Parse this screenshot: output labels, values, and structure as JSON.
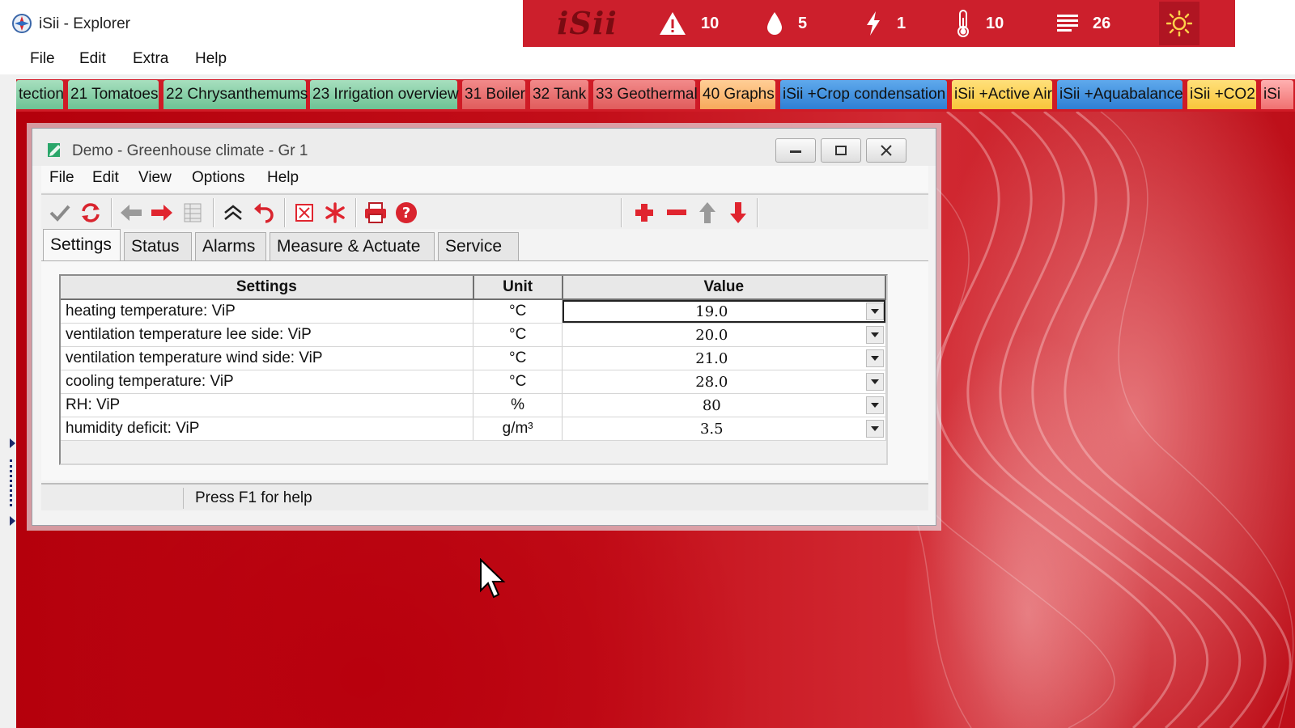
{
  "explorer": {
    "title": "iSii - Explorer",
    "menu": [
      "File",
      "Edit",
      "Extra",
      "Help"
    ]
  },
  "status_strip": {
    "logo": "iSii",
    "alarms": "10",
    "water": "5",
    "power": "1",
    "temperature": "10",
    "list": "26",
    "accent": "#cc1f2c"
  },
  "tabs": [
    {
      "label": "tection",
      "color": "green"
    },
    {
      "label": "21 Tomatoes",
      "color": "green"
    },
    {
      "label": "22 Chrysanthemums",
      "color": "green"
    },
    {
      "label": "23 Irrigation overview",
      "color": "green"
    },
    {
      "label": "31 Boiler",
      "color": "red"
    },
    {
      "label": "32 Tank",
      "color": "red"
    },
    {
      "label": "33 Geothermal",
      "color": "red"
    },
    {
      "label": "40 Graphs",
      "color": "orange"
    },
    {
      "label": "iSii +Crop condensation",
      "color": "blue"
    },
    {
      "label": "iSii +Active Air",
      "color": "yellow"
    },
    {
      "label": "iSii +Aquabalance",
      "color": "blue"
    },
    {
      "label": "iSii +CO2",
      "color": "yellow"
    },
    {
      "label": "iSi",
      "color": "pink"
    }
  ],
  "dialog": {
    "title": "Demo - Greenhouse climate - Gr 1",
    "menu": [
      "File",
      "Edit",
      "View",
      "Options",
      "Help"
    ],
    "tabs": [
      "Settings",
      "Status",
      "Alarms",
      "Measure & Actuate",
      "Service"
    ],
    "active_tab": "Settings",
    "table": {
      "headers": [
        "Settings",
        "Unit",
        "Value"
      ],
      "rows": [
        {
          "setting": "heating temperature: ViP",
          "unit": "°C",
          "value": "19.0"
        },
        {
          "setting": "ventilation temperature lee side: ViP",
          "unit": "°C",
          "value": "20.0"
        },
        {
          "setting": "ventilation temperature wind side: ViP",
          "unit": "°C",
          "value": "21.0"
        },
        {
          "setting": "cooling temperature: ViP",
          "unit": "°C",
          "value": "28.0"
        },
        {
          "setting": "RH: ViP",
          "unit": "%",
          "value": "80"
        },
        {
          "setting": "humidity deficit: ViP",
          "unit": "g/m³",
          "value": "3.5"
        }
      ]
    },
    "status_text": "Press F1 for help"
  }
}
